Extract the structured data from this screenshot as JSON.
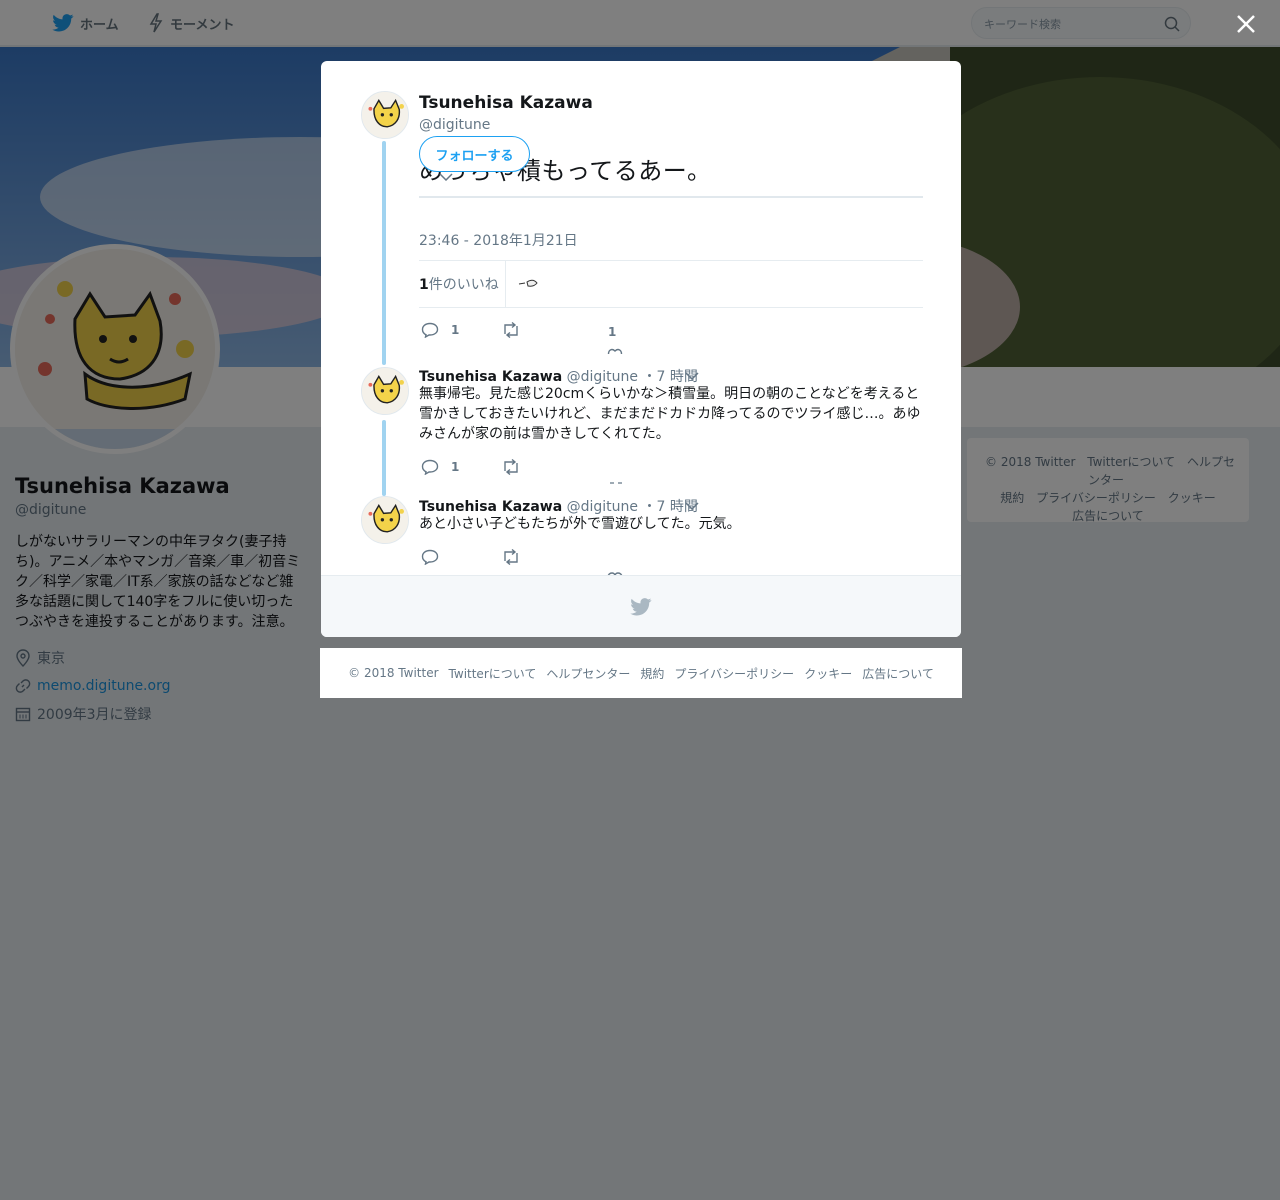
{
  "nav": {
    "home_label": "ホーム",
    "moments_label": "モーメント",
    "search_placeholder": "キーワード検索"
  },
  "profile": {
    "name": "Tsunehisa Kazawa",
    "handle": "@digitune",
    "bio": "しがないサラリーマンの中年ヲタク(妻子持ち)。アニメ／本やマンガ／音楽／車／初音ミク／科学／家電／IT系／家族の話などなど雑多な話題に関して140字をフルに使い切ったつぶやきを連投することがあります。注意。",
    "location": "東京",
    "url": "memo.digitune.org",
    "joined": "2009年3月に登録"
  },
  "side_footer": {
    "line1": [
      "© 2018 Twitter",
      "Twitterについて",
      "ヘルプセンター"
    ],
    "line2": [
      "規約",
      "プライバシーポリシー",
      "クッキー"
    ],
    "line3": [
      "広告について"
    ]
  },
  "main_tweet": {
    "name": "Tsunehisa Kazawa",
    "handle": "@digitune",
    "follow_label": "フォローする",
    "text": "めっちゃ積もってるあー。",
    "timestamp": "23:46 - 2018年1月21日",
    "likes_count": "1",
    "likes_label": "件のいいね",
    "reply_count": "1",
    "like_count": "1"
  },
  "replies": [
    {
      "name": "Tsunehisa Kazawa",
      "handle": "@digitune",
      "time": "・7 時間",
      "text": "無事帰宅。見た感じ20cmくらいかな＞積雪量。明日の朝のことなどを考えると雪かきしておきたいけれど、まだまだドカドカ降ってるのでツライ感じ…。あゆみさんが家の前は雪かきしてくれてた。",
      "reply_count": "1"
    },
    {
      "name": "Tsunehisa Kazawa",
      "handle": "@digitune",
      "time": "・7 時間",
      "text": "あと小さい子どもたちが外で雪遊びしてた。元気。",
      "reply_count": ""
    }
  ],
  "modal_footer": [
    "© 2018 Twitter",
    "Twitterについて",
    "ヘルプセンター",
    "規約",
    "プライバシーポリシー",
    "クッキー",
    "広告について"
  ],
  "colors": {
    "accent": "#1da1f2",
    "link": "#1b95e0",
    "thread_line": "#a0d3f0",
    "secondary_text": "#657786",
    "overlay": "rgba(0,0,0,0.5)"
  }
}
